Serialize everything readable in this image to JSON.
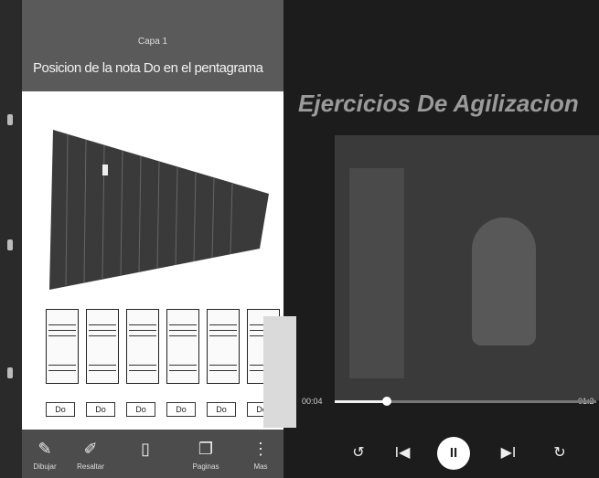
{
  "left_panel": {
    "subtitle": "Capa 1",
    "title": "Posicion de la nota Do en el pentagrama",
    "note_labels": [
      "Do",
      "Do",
      "Do",
      "Do",
      "Do",
      "Do"
    ],
    "bottom_bar": [
      {
        "icon": "pencil-icon",
        "label": "Dibujar"
      },
      {
        "icon": "highlighter-icon",
        "label": "Resaltar"
      },
      {
        "icon": "eraser-icon",
        "label": ""
      },
      {
        "icon": "pages-icon",
        "label": "Paginas"
      },
      {
        "icon": "more-icon",
        "label": "Mas"
      }
    ]
  },
  "video_panel": {
    "title": "Ejercicios De Agilizacion",
    "time_elapsed": "00:04",
    "time_remaining": "01:2",
    "progress": 0.2,
    "controls": [
      {
        "name": "rewind-10-icon",
        "glyph": "↺"
      },
      {
        "name": "previous-icon",
        "glyph": "I◀"
      },
      {
        "name": "pause-icon",
        "glyph": "II"
      },
      {
        "name": "next-icon",
        "glyph": "▶I"
      },
      {
        "name": "forward-10-icon",
        "glyph": "↻"
      }
    ]
  },
  "colors": {
    "accent": "#ffffff",
    "background": "#1c1c1c"
  }
}
